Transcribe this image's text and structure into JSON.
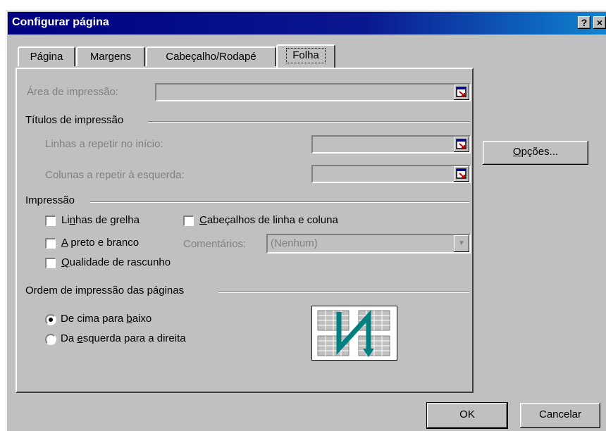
{
  "window": {
    "title": "Configurar página",
    "help_glyph": "?",
    "close_glyph": "×"
  },
  "tabs": [
    {
      "label": "Página"
    },
    {
      "label": "Margens"
    },
    {
      "label": "Cabeçalho/Rodapé"
    },
    {
      "label": "Folha",
      "active": true
    }
  ],
  "print_area": {
    "label": "Área de impressão:",
    "value": ""
  },
  "print_titles": {
    "group_label": "Títulos de impressão",
    "rows_label": "Linhas a repetir no início:",
    "rows_value": "",
    "cols_label": "Colunas a repetir à esquerda:",
    "cols_value": ""
  },
  "print": {
    "group_label": "Impressão",
    "gridlines": {
      "pre": "Li",
      "key": "n",
      "post": "has de grelha",
      "checked": false
    },
    "black_white": {
      "pre": "",
      "key": "A",
      "post": " preto e branco",
      "checked": false
    },
    "draft": {
      "pre": "",
      "key": "Q",
      "post": "ualidade de rascunho",
      "checked": false
    },
    "headings": {
      "pre": "",
      "key": "C",
      "post": "abeçalhos de linha e coluna",
      "checked": false
    },
    "comments_label": "Comentários:",
    "comments_value": "(Nenhum)"
  },
  "page_order": {
    "group_label": "Ordem de impressão das páginas",
    "down_then_over": {
      "pre": "De cima para ",
      "key": "b",
      "post": "aixo",
      "selected": true
    },
    "over_then_down": {
      "pre": "Da ",
      "key": "e",
      "post": "squerda para a direita",
      "selected": false
    }
  },
  "buttons": {
    "options": {
      "pre": "",
      "key": "O",
      "post": "pções..."
    },
    "ok": "OK",
    "cancel": "Cancelar"
  },
  "colors": {
    "face": "#c0c0c0",
    "title_bar": "#000080",
    "order_arrow": "#008080"
  },
  "icons": {
    "ref_button": "collapse-dialog-icon",
    "order_preview": "page-order-down-then-over-icon"
  }
}
